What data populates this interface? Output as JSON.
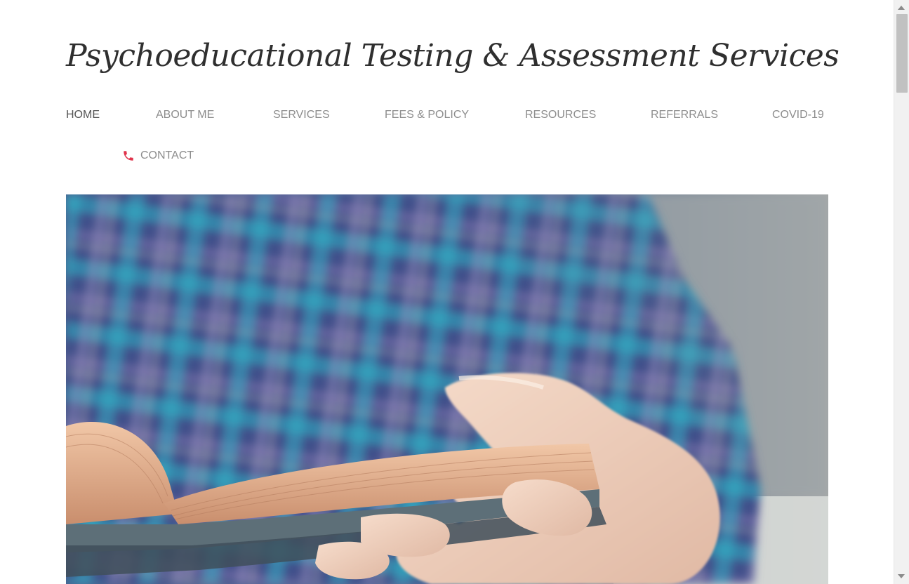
{
  "site": {
    "title": "Psychoeducational Testing & Assessment Services"
  },
  "nav": {
    "items": [
      {
        "label": "HOME",
        "active": true
      },
      {
        "label": "ABOUT ME",
        "active": false
      },
      {
        "label": "SERVICES",
        "active": false
      },
      {
        "label": "FEES & POLICY",
        "active": false
      },
      {
        "label": "RESOURCES",
        "active": false
      },
      {
        "label": "REFERRALS",
        "active": false
      },
      {
        "label": "COVID-19",
        "active": false
      }
    ],
    "contact": {
      "label": "CONTACT",
      "icon": "phone-icon",
      "icon_color": "#e0334b"
    }
  },
  "hero": {
    "image": "photo of a person in a blue plaid shirt holding an open book"
  },
  "colors": {
    "title": "#2f2f2f",
    "nav_active": "#555555",
    "nav_inactive": "#8d8d8d"
  }
}
